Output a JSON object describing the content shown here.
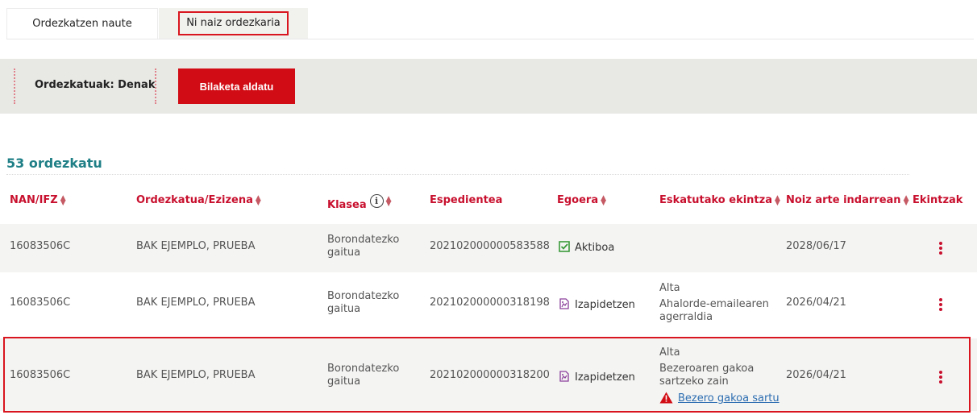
{
  "tabs": [
    {
      "label": "Ordezkatzen naute"
    },
    {
      "label": "Ni naiz ordezkaria"
    }
  ],
  "filter": {
    "label": "Ordezkatuak: Denak",
    "button": "Bilaketa aldatu"
  },
  "count_label": "53 ordezkatu",
  "table": {
    "headers": [
      "NAN/IFZ",
      "Ordezkatua/Ezizena",
      "Klasea",
      "Espedientea",
      "Egoera",
      "Eskatutako ekintza",
      "Noiz arte indarrean",
      "Ekintzak"
    ],
    "rows": [
      {
        "nan": "16083506C",
        "name": "BAK EJEMPLO, PRUEBA",
        "class_line1": "Borondatezko",
        "class_line2": "gaitua",
        "file": "202102000000583588",
        "status": "Aktiboa",
        "status_icon": "check-icon",
        "action_type": "",
        "action_line1": "",
        "action_line2": "",
        "valid_until": "2028/06/17"
      },
      {
        "nan": "16083506C",
        "name": "BAK EJEMPLO, PRUEBA",
        "class_line1": "Borondatezko",
        "class_line2": "gaitua",
        "file": "202102000000318198",
        "status": "Izapidetzen",
        "status_icon": "processing-document-icon",
        "action_type": "Alta",
        "action_line1": "Ahalorde-emailearen",
        "action_line2": "agerraldia",
        "valid_until": "2026/04/21"
      },
      {
        "nan": "16083506C",
        "name": "BAK EJEMPLO, PRUEBA",
        "class_line1": "Borondatezko",
        "class_line2": "gaitua",
        "file": "202102000000318200",
        "status": "Izapidetzen",
        "status_icon": "processing-document-icon",
        "action_type": "Alta",
        "action_line1": "Bezeroaren gakoa",
        "action_line2": "sartzeko zain",
        "action_link": "Bezero gakoa sartu",
        "valid_until": "2026/04/21"
      }
    ]
  },
  "colors": {
    "accent_red": "#d20c14",
    "header_red": "#c8102e",
    "count_teal": "#1f7f86",
    "link_blue": "#2c6db0"
  }
}
